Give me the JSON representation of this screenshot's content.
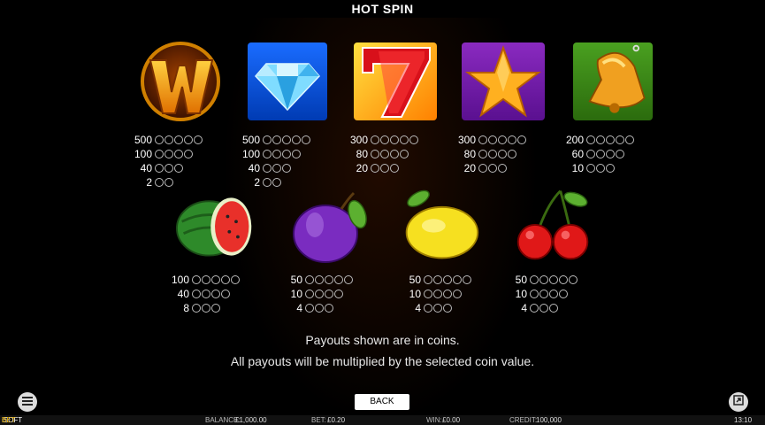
{
  "header": {
    "title": "HOT SPIN"
  },
  "symbols_row1": [
    {
      "name": "wild-w",
      "payouts": [
        {
          "value": "500",
          "coins": 5
        },
        {
          "value": "100",
          "coins": 4
        },
        {
          "value": "40",
          "coins": 3
        },
        {
          "value": "2",
          "coins": 2
        }
      ]
    },
    {
      "name": "diamond",
      "payouts": [
        {
          "value": "500",
          "coins": 5
        },
        {
          "value": "100",
          "coins": 4
        },
        {
          "value": "40",
          "coins": 3
        },
        {
          "value": "2",
          "coins": 2
        }
      ]
    },
    {
      "name": "seven",
      "payouts": [
        {
          "value": "300",
          "coins": 5
        },
        {
          "value": "80",
          "coins": 4
        },
        {
          "value": "20",
          "coins": 3
        }
      ]
    },
    {
      "name": "star",
      "payouts": [
        {
          "value": "300",
          "coins": 5
        },
        {
          "value": "80",
          "coins": 4
        },
        {
          "value": "20",
          "coins": 3
        }
      ]
    },
    {
      "name": "bell",
      "payouts": [
        {
          "value": "200",
          "coins": 5
        },
        {
          "value": "60",
          "coins": 4
        },
        {
          "value": "10",
          "coins": 3
        }
      ]
    }
  ],
  "symbols_row2": [
    {
      "name": "watermelon",
      "payouts": [
        {
          "value": "100",
          "coins": 5
        },
        {
          "value": "40",
          "coins": 4
        },
        {
          "value": "8",
          "coins": 3
        }
      ]
    },
    {
      "name": "plum",
      "payouts": [
        {
          "value": "50",
          "coins": 5
        },
        {
          "value": "10",
          "coins": 4
        },
        {
          "value": "4",
          "coins": 3
        }
      ]
    },
    {
      "name": "lemon",
      "payouts": [
        {
          "value": "50",
          "coins": 5
        },
        {
          "value": "10",
          "coins": 4
        },
        {
          "value": "4",
          "coins": 3
        }
      ]
    },
    {
      "name": "cherry",
      "payouts": [
        {
          "value": "50",
          "coins": 5
        },
        {
          "value": "10",
          "coins": 4
        },
        {
          "value": "4",
          "coins": 3
        }
      ]
    }
  ],
  "notes": {
    "line1": "Payouts shown are in coins.",
    "line2": "All payouts will be multiplied by the selected coin value."
  },
  "back_label": "BACK",
  "bottom_bar": {
    "brand_prefix": "iSOFT",
    "brand_suffix": "BET",
    "balance_label": "BALANCE:",
    "balance_value": "£1,000.00",
    "bet_label": "BET:",
    "bet_value": "£0.20",
    "win_label": "WIN:",
    "win_value": "£0.00",
    "credit_label": "CREDIT:",
    "credit_value": "100,000",
    "clock": "13:10"
  },
  "icons": {
    "menu": "menu-icon",
    "history": "history-icon"
  },
  "colors": {
    "background": "#000000",
    "brand_accent": "#f5b800"
  }
}
